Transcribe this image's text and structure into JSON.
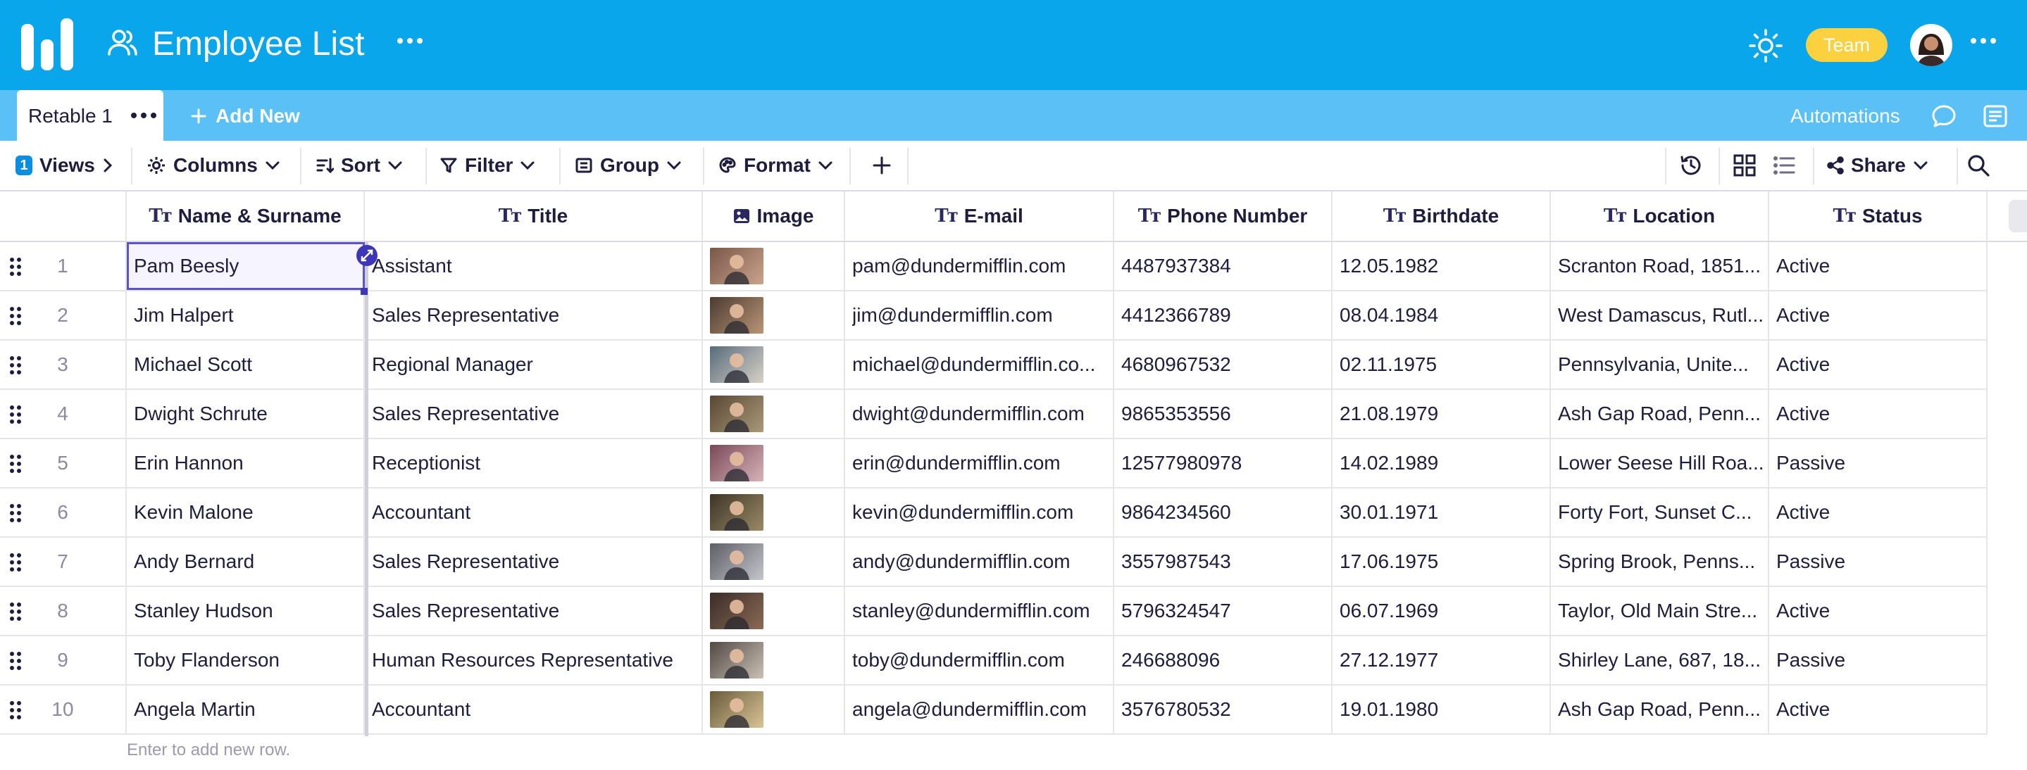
{
  "header": {
    "title": "Employee List",
    "team_badge": "Team",
    "colors": {
      "header_bg": "#0aa6ec",
      "tab_bar_bg": "#5bc0f5",
      "badge": "#fbd13f",
      "accent": "#3d36b8"
    }
  },
  "tabbar": {
    "active_tab": "Retable 1",
    "add_new": "Add New",
    "automations": "Automations"
  },
  "toolbar": {
    "views_count": "1",
    "views": "Views",
    "columns": "Columns",
    "sort": "Sort",
    "filter": "Filter",
    "group": "Group",
    "format": "Format",
    "share": "Share"
  },
  "grid": {
    "columns": [
      {
        "key": "name",
        "label": "Name & Surname",
        "icon": "text-type-icon"
      },
      {
        "key": "title",
        "label": "Title",
        "icon": "text-type-icon"
      },
      {
        "key": "image",
        "label": "Image",
        "icon": "image-icon"
      },
      {
        "key": "email",
        "label": "E-mail",
        "icon": "text-type-icon"
      },
      {
        "key": "phone",
        "label": "Phone Number",
        "icon": "text-type-icon"
      },
      {
        "key": "birthdate",
        "label": "Birthdate",
        "icon": "text-type-icon"
      },
      {
        "key": "location",
        "label": "Location",
        "icon": "text-type-icon"
      },
      {
        "key": "status",
        "label": "Status",
        "icon": "text-type-icon"
      }
    ],
    "rows": [
      {
        "num": "1",
        "name": "Pam Beesly",
        "title": "Assistant",
        "email": "pam@dundermifflin.com",
        "phone": "4487937384",
        "birthdate": "12.05.1982",
        "location": "Scranton Road, 1851...",
        "status": "Active"
      },
      {
        "num": "2",
        "name": "Jim Halpert",
        "title": "Sales Representative",
        "email": "jim@dundermifflin.com",
        "phone": "4412366789",
        "birthdate": "08.04.1984",
        "location": "West Damascus, Rutl...",
        "status": "Active"
      },
      {
        "num": "3",
        "name": "Michael Scott",
        "title": "Regional Manager",
        "email": "michael@dundermifflin.co...",
        "phone": "4680967532",
        "birthdate": "02.11.1975",
        "location": "Pennsylvania, Unite...",
        "status": "Active"
      },
      {
        "num": "4",
        "name": "Dwight Schrute",
        "title": "Sales Representative",
        "email": "dwight@dundermifflin.com",
        "phone": "9865353556",
        "birthdate": "21.08.1979",
        "location": "Ash Gap Road, Penn...",
        "status": "Active"
      },
      {
        "num": "5",
        "name": "Erin Hannon",
        "title": "Receptionist",
        "email": "erin@dundermifflin.com",
        "phone": "12577980978",
        "birthdate": "14.02.1989",
        "location": "Lower Seese Hill Roa...",
        "status": "Passive"
      },
      {
        "num": "6",
        "name": "Kevin Malone",
        "title": "Accountant",
        "email": "kevin@dundermifflin.com",
        "phone": "9864234560",
        "birthdate": "30.01.1971",
        "location": "Forty Fort, Sunset C...",
        "status": "Active"
      },
      {
        "num": "7",
        "name": "Andy Bernard",
        "title": "Sales Representative",
        "email": "andy@dundermifflin.com",
        "phone": "3557987543",
        "birthdate": "17.06.1975",
        "location": "Spring Brook, Penns...",
        "status": "Passive"
      },
      {
        "num": "8",
        "name": "Stanley Hudson",
        "title": "Sales Representative",
        "email": "stanley@dundermifflin.com",
        "phone": "5796324547",
        "birthdate": "06.07.1969",
        "location": "Taylor, Old Main Stre...",
        "status": "Active"
      },
      {
        "num": "9",
        "name": "Toby Flanderson",
        "title": "Human Resources Representative",
        "email": "toby@dundermifflin.com",
        "phone": "246688096",
        "birthdate": "27.12.1977",
        "location": "Shirley Lane, 687, 18...",
        "status": "Passive"
      },
      {
        "num": "10",
        "name": "Angela Martin",
        "title": "Accountant",
        "email": "angela@dundermifflin.com",
        "phone": "3576780532",
        "birthdate": "19.01.1980",
        "location": "Ash Gap Road, Penn...",
        "status": "Active"
      }
    ],
    "add_row_hint": "Enter to add new row."
  }
}
